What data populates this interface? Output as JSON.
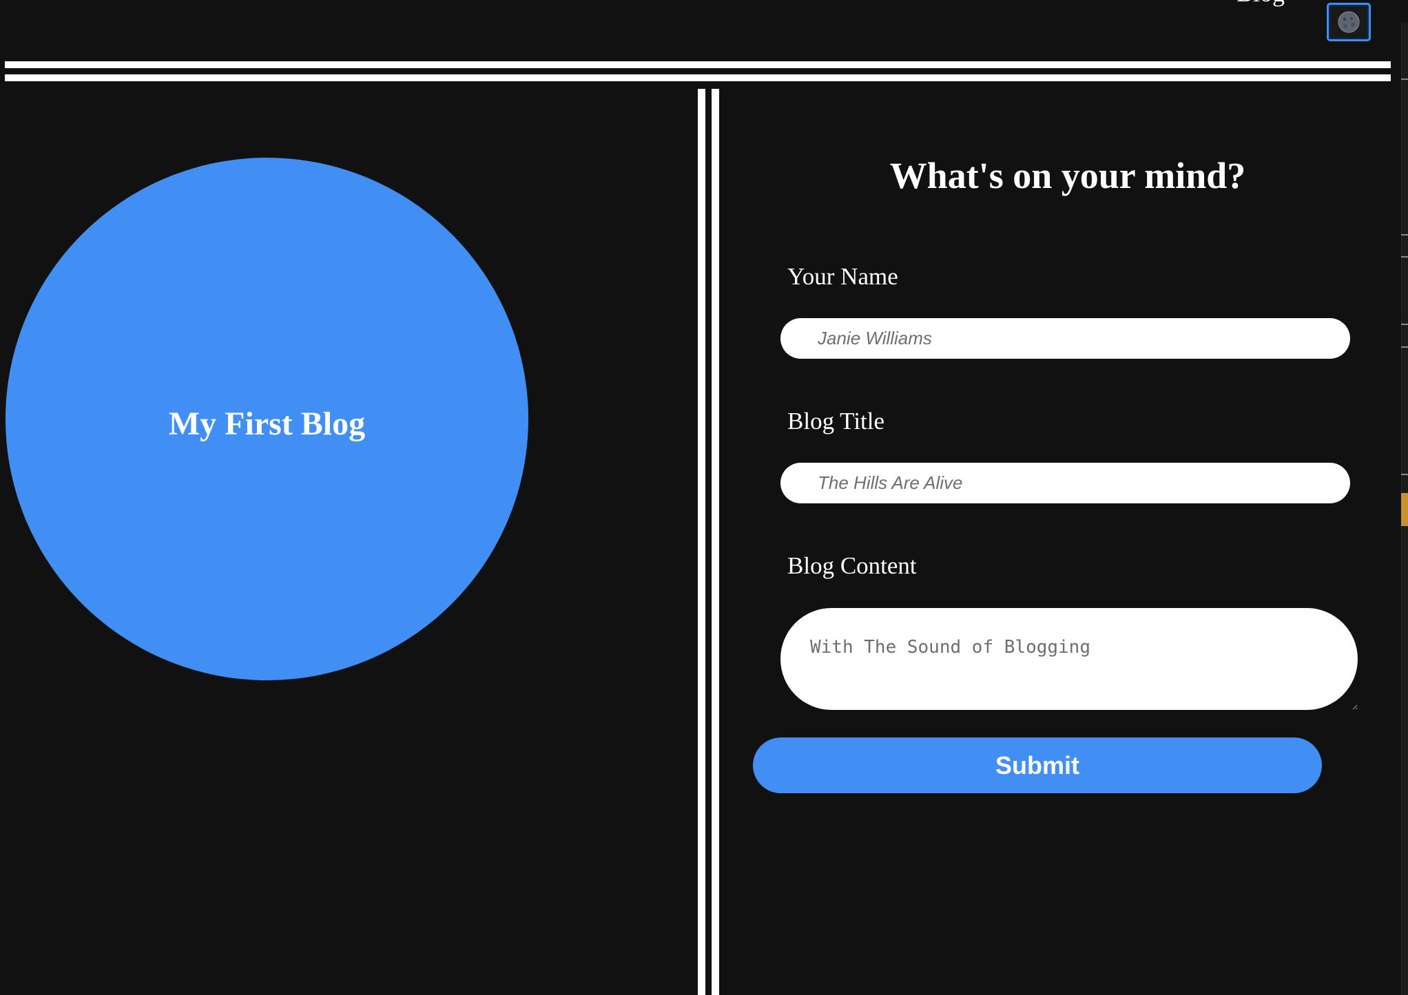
{
  "nav": {
    "blog_link": "Blog",
    "theme_toggle_icon": "moon-icon"
  },
  "hero": {
    "title": "My First Blog",
    "circle_color": "#418ff4"
  },
  "form": {
    "heading": "What's on your mind?",
    "name_label": "Your Name",
    "name_placeholder": "Janie Williams",
    "title_label": "Blog Title",
    "title_placeholder": "The Hills Are Alive",
    "content_label": "Blog Content",
    "content_placeholder": "With The Sound of Blogging",
    "submit_label": "Submit",
    "accent_color": "#418ff4"
  },
  "colors": {
    "background": "#111111",
    "text": "#ffffff",
    "accent": "#418ff4"
  }
}
